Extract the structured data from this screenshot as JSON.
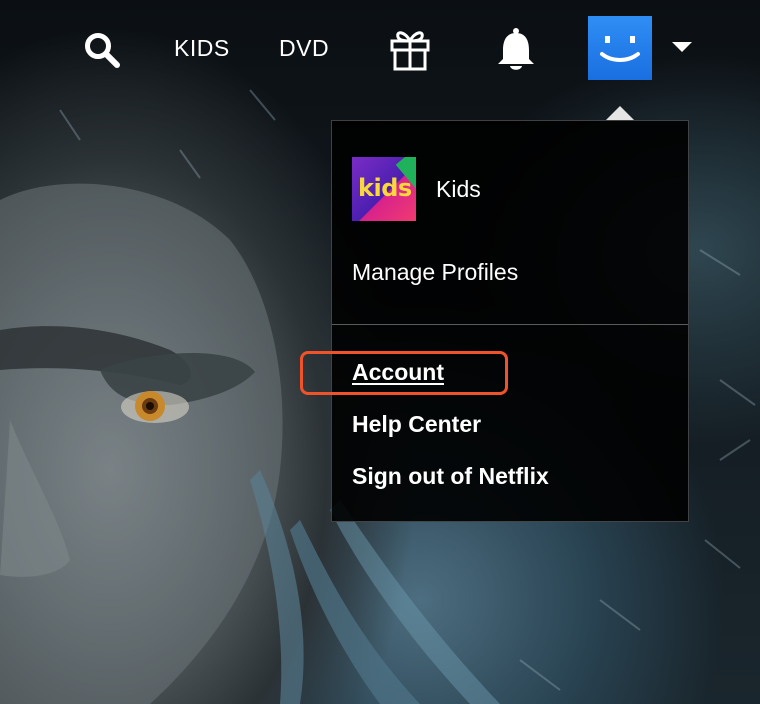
{
  "nav": {
    "kids_label": "KIDS",
    "dvd_label": "DVD",
    "search_icon": "search-icon",
    "gift_icon": "gift-icon",
    "bell_icon": "bell-icon",
    "caret_icon": "caret-down-icon"
  },
  "dropdown": {
    "profile": {
      "name": "Kids",
      "thumb_text": "kids"
    },
    "manage_label": "Manage Profiles",
    "links": {
      "account": "Account",
      "help": "Help Center",
      "signout": "Sign out of Netflix"
    }
  },
  "colors": {
    "avatar": "#2f8ef5",
    "highlight": "#f0532a",
    "kids_logo": "#f7d93a"
  }
}
